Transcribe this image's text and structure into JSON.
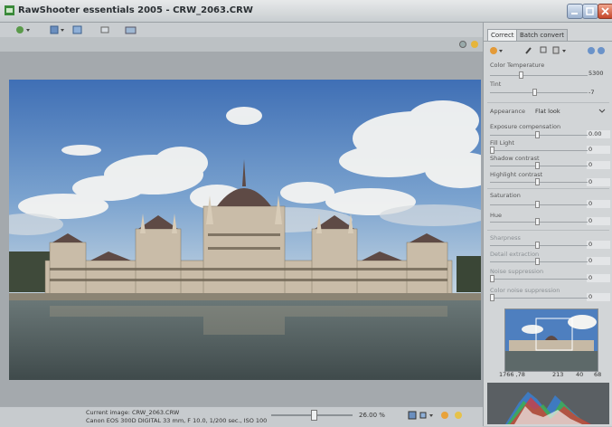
{
  "window": {
    "title": "RawShooter essentials 2005 - CRW_2063.CRW"
  },
  "tabs": {
    "correct": "Correct",
    "batch": "Batch convert"
  },
  "panel": {
    "color_temperature_label": "Color Temperature",
    "color_temperature_value": "5300",
    "tint_label": "Tint",
    "tint_value": "-7",
    "appearance_label": "Appearance",
    "appearance_value": "Flat look",
    "exposure_label": "Exposure compensation",
    "exposure_value": "0.00",
    "fill_light_label": "Fill Light",
    "fill_light_value": "0",
    "shadow_contrast_label": "Shadow contrast",
    "shadow_contrast_value": "0",
    "highlight_contrast_label": "Highlight contrast",
    "highlight_contrast_value": "0",
    "saturation_label": "Saturation",
    "saturation_value": "0",
    "hue_label": "Hue",
    "hue_value": "0",
    "sharpness_label": "Sharpness",
    "sharpness_value": "0",
    "detail_extraction_label": "Detail extraction",
    "detail_extraction_value": "0",
    "noise_suppression_label": "Noise suppression",
    "noise_suppression_value": "0",
    "color_noise_label": "Color noise suppression",
    "color_noise_value": "0",
    "nav_readout": {
      "a": "1766 ,78",
      "b": "213",
      "c": "40",
      "d": "68"
    }
  },
  "status": {
    "current_image": "Current image: CRW_2063.CRW",
    "exif": "Canon EOS 300D DIGITAL  33 mm, F 10.0, 1/200 sec., ISO 100",
    "zoom": "26.00 %"
  }
}
